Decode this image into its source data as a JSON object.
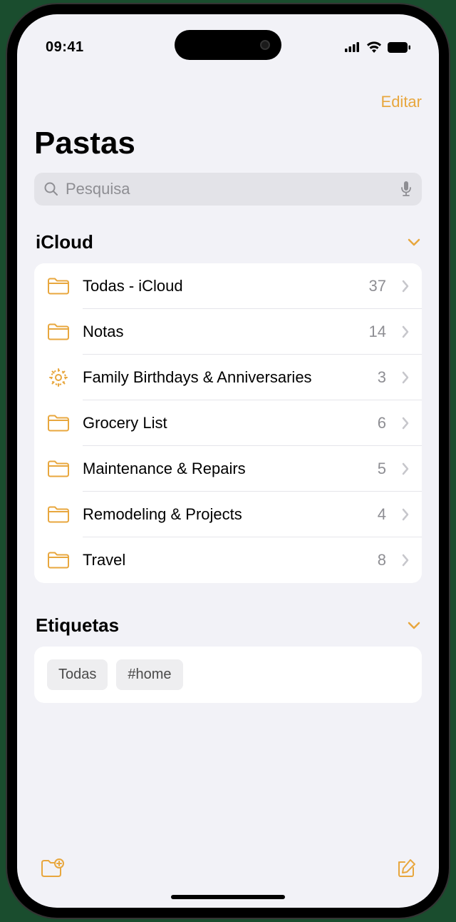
{
  "statusBar": {
    "time": "09:41"
  },
  "navBar": {
    "edit": "Editar"
  },
  "pageTitle": "Pastas",
  "search": {
    "placeholder": "Pesquisa"
  },
  "sections": {
    "icloud": {
      "title": "iCloud",
      "folders": [
        {
          "name": "Todas - iCloud",
          "count": "37",
          "iconType": "folder"
        },
        {
          "name": "Notas",
          "count": "14",
          "iconType": "folder"
        },
        {
          "name": "Family Birthdays & Anniversaries",
          "count": "3",
          "iconType": "gear"
        },
        {
          "name": "Grocery List",
          "count": "6",
          "iconType": "folder"
        },
        {
          "name": "Maintenance & Repairs",
          "count": "5",
          "iconType": "folder"
        },
        {
          "name": "Remodeling & Projects",
          "count": "4",
          "iconType": "folder"
        },
        {
          "name": "Travel",
          "count": "8",
          "iconType": "folder"
        }
      ]
    },
    "tags": {
      "title": "Etiquetas",
      "items": [
        "Todas",
        "#home"
      ]
    }
  },
  "colors": {
    "accent": "#e8a73e",
    "background": "#f2f2f7"
  }
}
